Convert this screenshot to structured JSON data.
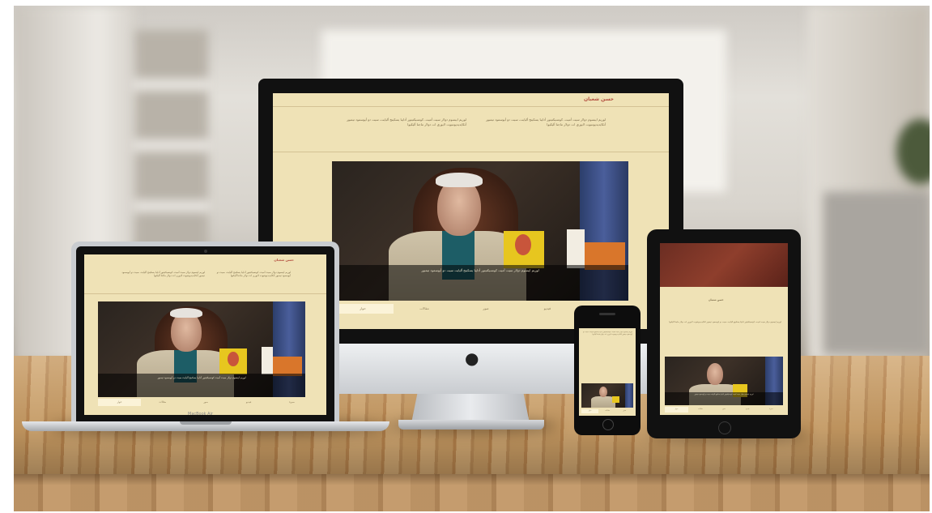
{
  "scene": {
    "description_tags": [
      "imac",
      "macbook",
      "iphone",
      "ipad"
    ],
    "laptop_brand": "MacBook Air"
  },
  "site": {
    "title": "حسن شعبان",
    "body_text": "لوريم ايبسوم دولار سيت أميت، كونسيكتيتور أدايبا يسكينج أليايت، سيت دو أيوسمود تيمبور أنكايديديونتيوت لابوري ات دولار ماجنا أليكيوا",
    "caption": "لوريم ايبسوم دولار سيت أميت كونسيكتيتور أدايبا يسكينج أليايت سيت دو أيوسمود تيمبور",
    "tabs": [
      "حوار",
      "مقالات",
      "صور",
      "فيديو",
      "سيرة"
    ]
  },
  "colors": {
    "site_bg": "#efe2b6",
    "title_red": "#b24a3c",
    "table_wood": "#c79a62"
  }
}
